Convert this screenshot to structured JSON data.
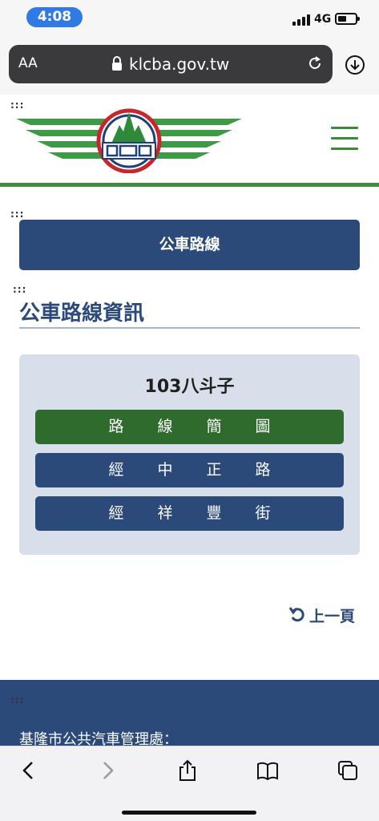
{
  "status_bar": {
    "time": "4:08",
    "network": "4G"
  },
  "browser": {
    "text_size_label": "AA",
    "domain": "klcba.gov.tw"
  },
  "header": {
    "dots": ":::"
  },
  "content": {
    "banner": "公車路線",
    "page_title": "公車路線資訊",
    "route_name": "103八斗子",
    "buttons": [
      "路線簡圖",
      "經中正路",
      "經祥豐街"
    ],
    "prev_link": "上一頁"
  },
  "footer": {
    "org_name": "基隆市公共汽車管理處："
  },
  "colors": {
    "navy": "#2b4a7a",
    "green": "#2e6b2c",
    "card": "#d9dfea",
    "rule_green": "#3f8c3f"
  }
}
